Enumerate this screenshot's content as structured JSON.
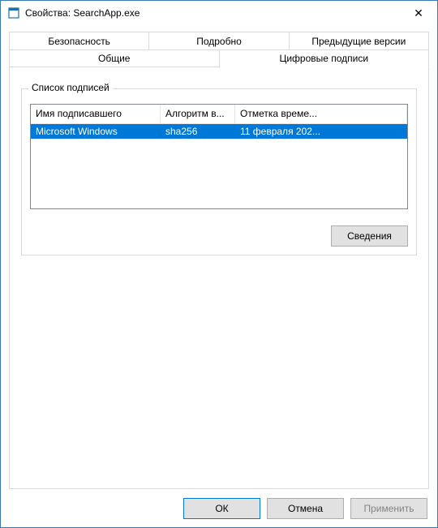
{
  "window": {
    "title": "Свойства: SearchApp.exe",
    "close_tooltip": "Закрыть"
  },
  "tabs": {
    "row1": [
      "Безопасность",
      "Подробно",
      "Предыдущие версии"
    ],
    "row2": [
      "Общие",
      "Цифровые подписи"
    ],
    "active": "Цифровые подписи"
  },
  "group": {
    "label": "Список подписей"
  },
  "listview": {
    "headers": [
      "Имя подписавшего",
      "Алгоритм в...",
      "Отметка време..."
    ],
    "rows": [
      {
        "signer": "Microsoft Windows",
        "algo": "sha256",
        "timestamp": "11 февраля 202...",
        "selected": true
      }
    ]
  },
  "buttons": {
    "details": "Сведения",
    "ok": "ОК",
    "cancel": "Отмена",
    "apply": "Применить"
  }
}
